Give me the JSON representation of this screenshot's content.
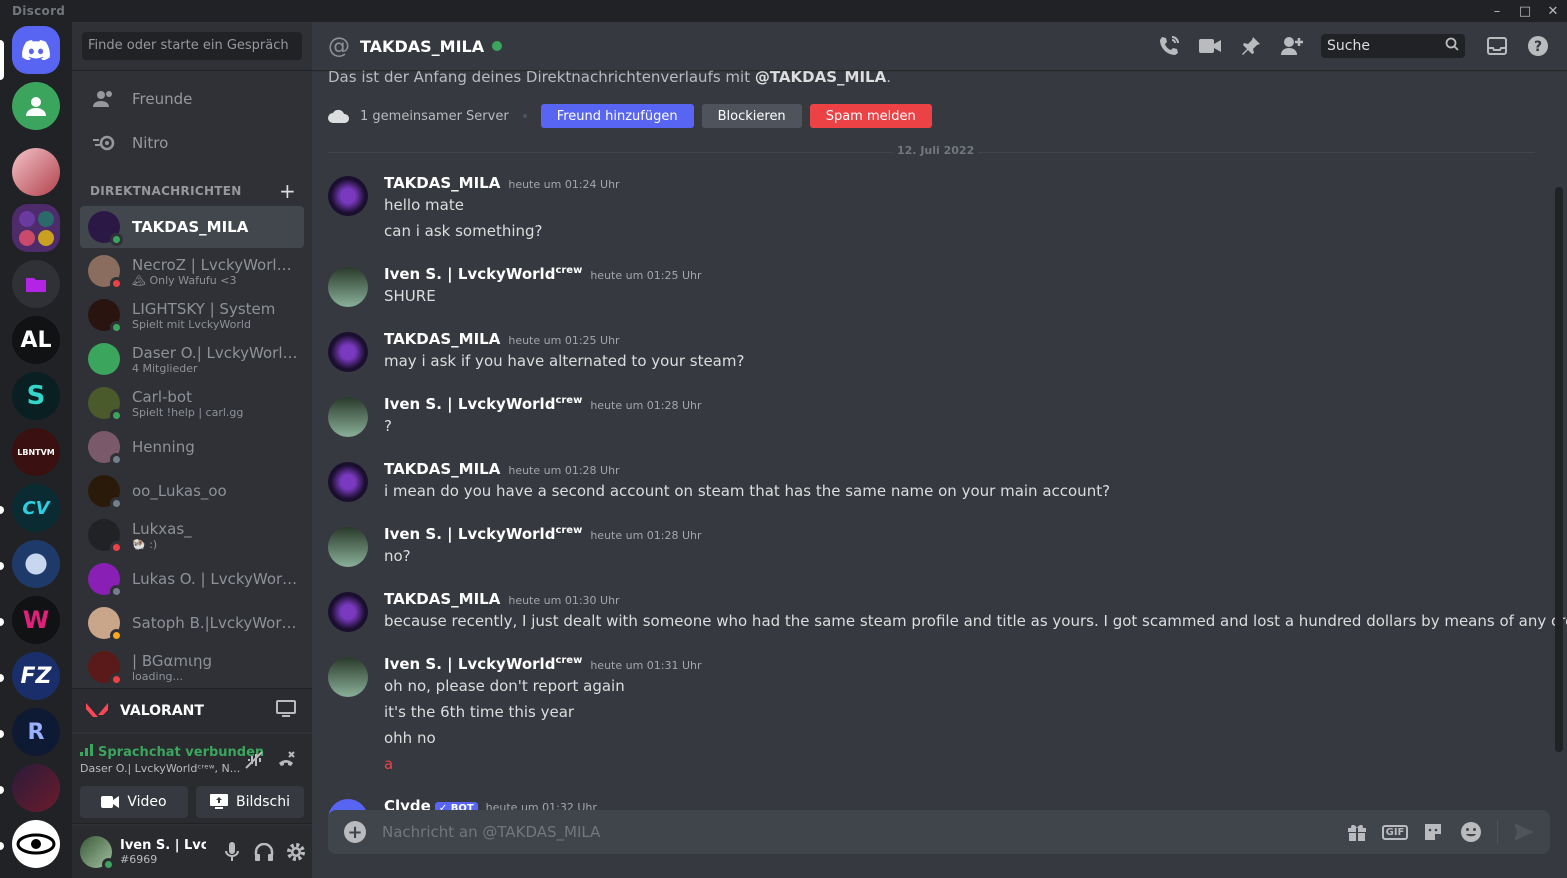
{
  "app": {
    "title": "Discord",
    "accent": "#5865f2"
  },
  "window_controls": {
    "minimize": "–",
    "maximize": "□",
    "close": "✕"
  },
  "rail": {
    "items": [
      {
        "name": "home",
        "color": "#5865f2"
      },
      {
        "name": "voice-group",
        "color": "#3ba55d"
      },
      {
        "name": "anime-server",
        "color": "#e8b4b8"
      },
      {
        "name": "folder-server",
        "color": "#4e2b6b"
      },
      {
        "name": "purple-folder",
        "color": "#2f3136"
      },
      {
        "name": "al-server",
        "color": "#111214"
      },
      {
        "name": "s-server",
        "color": "#0a1f22"
      },
      {
        "name": "lbntvm-server",
        "color": "#3a1010"
      },
      {
        "name": "cv-server",
        "color": "#0b2b33"
      },
      {
        "name": "crest-server",
        "color": "#1d3a6b"
      },
      {
        "name": "w-server",
        "color": "#111214"
      },
      {
        "name": "fz-server",
        "color": "#1a2e6b"
      },
      {
        "name": "r-server",
        "color": "#0e1a33"
      },
      {
        "name": "red-server",
        "color": "#3b1b2b"
      },
      {
        "name": "eye-server",
        "color": "#ffffff"
      }
    ],
    "labels": {
      "al": "AL",
      "s": "S",
      "lbntvm": "LBNTVM",
      "cv": "CV",
      "w": "W",
      "fz": "FZ",
      "r": "R"
    }
  },
  "sidebar": {
    "search_placeholder": "Finde oder starte ein Gespräch",
    "nav": [
      {
        "label": "Freunde"
      },
      {
        "label": "Nitro"
      }
    ],
    "dm_header": "DIREKTNACHRICHTEN",
    "dm_add": "+",
    "dms": [
      {
        "name": "TAKDAS_MILA",
        "sub": "",
        "status": "online",
        "color": "#2b1845",
        "active": true
      },
      {
        "name": "NecroZ | LvckyWorldᶜʳᵉʷ",
        "sub": "🏔 Only Wafufu <3",
        "status": "dnd",
        "color": "#8a6d5e"
      },
      {
        "name": "LIGHTSKY | System",
        "sub": "Spielt mit LvckyWorld",
        "status": "online",
        "color": "#2a1410"
      },
      {
        "name": "Daser O.| LvckyWorldᶜʳᵉʷ, N...",
        "sub": "4 Mitglieder",
        "status": "",
        "color": "#3ba55d"
      },
      {
        "name": "Carl-bot",
        "sub": "Spielt !help | carl.gg",
        "status": "online",
        "color": "#4a5a2a"
      },
      {
        "name": "Henning",
        "sub": "",
        "status": "offline",
        "color": "#7a5a6a"
      },
      {
        "name": "oo_Lukas_oo",
        "sub": "",
        "status": "offline",
        "color": "#2a1a0a"
      },
      {
        "name": "Lukxas_",
        "sub": "🐏 :)",
        "status": "dnd",
        "color": "#202225"
      },
      {
        "name": "Lukas O. | LvckyWorld...",
        "sub": "",
        "status": "offline",
        "color": "#8a1fb5"
      },
      {
        "name": "Satoph B.|LvckyWorld....",
        "sub": "",
        "status": "idle",
        "color": "#c9a58a"
      },
      {
        "name": "| BGαmιηg",
        "sub": "loading...",
        "status": "dnd",
        "color": "#5a1a1a"
      }
    ],
    "activity": {
      "name": "VALORANT"
    },
    "voice": {
      "status": "Sprachchat verbunden",
      "channel": "Daser O.| LvckyWorldᶜʳᵉʷ, N...",
      "video_label": "Video",
      "screen_label": "Bildschi"
    },
    "user": {
      "name": "Iven S. | Lvc...",
      "tag": "#6969"
    }
  },
  "header": {
    "title": "TAKDAS_MILA",
    "search_placeholder": "Suche"
  },
  "intro": {
    "text": "Das ist der Anfang deines Direktnachrichtenverlaufs mit ",
    "mention": "@TAKDAS_MILA",
    "suffix": ".",
    "mutual": "1 gemeinsamer Server",
    "add_friend": "Freund hinzufügen",
    "block": "Blockieren",
    "report": "Spam melden"
  },
  "date_divider": "12. Juli 2022",
  "messages": [
    {
      "author": "TAKDAS_MILA",
      "crew": "",
      "time": "heute um 01:24 Uhr",
      "lines": [
        "hello mate",
        "can i ask something?"
      ]
    },
    {
      "author": "Iven S. | LvckyWorld",
      "crew": "crew",
      "time": "heute um 01:25 Uhr",
      "lines": [
        "SHURE"
      ]
    },
    {
      "author": "TAKDAS_MILA",
      "crew": "",
      "time": "heute um 01:25 Uhr",
      "lines": [
        "may i ask if you have alternated to your steam?"
      ]
    },
    {
      "author": "Iven S. | LvckyWorld",
      "crew": "crew",
      "time": "heute um 01:28 Uhr",
      "lines": [
        "?"
      ]
    },
    {
      "author": "TAKDAS_MILA",
      "crew": "",
      "time": "heute um 01:28 Uhr",
      "lines": [
        "i mean do you have a second account on steam that has the same name on your main account?"
      ]
    },
    {
      "author": "Iven S. | LvckyWorld",
      "crew": "crew",
      "time": "heute um 01:28 Uhr",
      "lines": [
        "no?"
      ]
    },
    {
      "author": "TAKDAS_MILA",
      "crew": "",
      "time": "heute um 01:30 Uhr",
      "lines": [
        "because recently, I just dealt with someone who had the same steam profile and title as yours. I got scammed and lost a hundred dollars by means of any credit card."
      ]
    },
    {
      "author": "Iven S. | LvckyWorld",
      "crew": "crew",
      "time": "heute um 01:31 Uhr",
      "lines": [
        "oh no, please don't report again",
        "it's the 6th time this year",
        "ohh no",
        "a"
      ]
    },
    {
      "author": "Clyde",
      "badge": "✓ BOT",
      "time": "heute um 01:32 Uhr",
      "lines": []
    }
  ],
  "composer": {
    "placeholder": "Nachricht an @TAKDAS_MILA",
    "gif": "GIF",
    "plus": "+"
  }
}
